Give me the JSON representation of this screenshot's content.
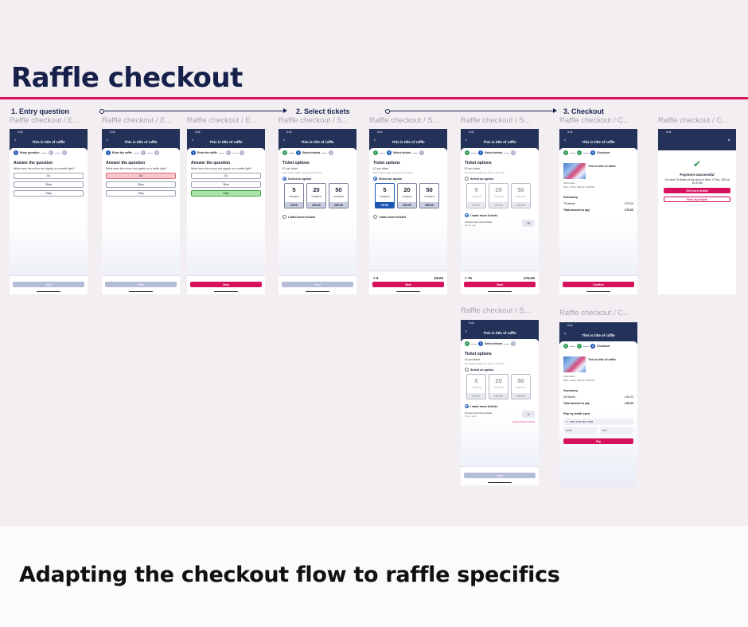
{
  "title": "Raffle checkout",
  "bottom_text": "Adapting the checkout flow to raffle specifics",
  "steps": [
    "1. Entry question",
    "2. Select tickets",
    "3. Checkout"
  ],
  "labels": {
    "entry": "Raffle checkout / E...",
    "select": "Raffle checkout / S...",
    "checkout": "Raffle checkout / C..."
  },
  "phone": {
    "status": "9:41",
    "raffle_title": "This is title of raffle",
    "back": "‹",
    "close": "×"
  },
  "entry": {
    "prog1": "Entry question",
    "prog2": "Enter the raffle",
    "h": "Answer the question",
    "q": "What does the colour red signify on a traffic light?",
    "opts": [
      "Go",
      "Slow",
      "Stop"
    ],
    "next": "Next"
  },
  "tickets": {
    "prog": "Select tickets",
    "h": "Ticket options",
    "price": "£1 per ticket",
    "note": "Each ticket equals one entry in the draw",
    "select": "Select an option",
    "more": "I want more tickets",
    "tlabel": "TICKETS",
    "nums": [
      "5",
      "20",
      "50"
    ],
    "prices": [
      "£5.00",
      "£20.00",
      "£50.00"
    ],
    "choose": "Choose how many tickets",
    "tap": "Tap to edit",
    "qty75": "75",
    "qty3": "3",
    "err": "Enter at least 5 tickets",
    "cart5": "× 5",
    "total5": "£5.00",
    "cart75": "× 75",
    "total75": "£75.00",
    "next": "Next"
  },
  "checkout": {
    "prog": "Checkout",
    "raffle": "This is title of raffle",
    "show": "Show dates",
    "date": "Wed, 17 Dec 2024 at 11:00 AM",
    "summary": "Summary",
    "t75": "75 tickets",
    "v75": "£75.00",
    "total": "Total amount to pay",
    "t35": "35 tickets",
    "v35": "£35.00",
    "confirm": "Confirm",
    "paytitle": "Pay by debit card",
    "card": "9087 4765 0001 2648",
    "exp": "12/24",
    "cvc": "123",
    "pay": "Pay"
  },
  "success": {
    "title": "Payment successful",
    "desc": "You have 75 tickets for the draw on Wed, 17 Dec, 2024 at 11:00 AM",
    "btn1": "Get more tickets",
    "btn2": "View my tickets"
  },
  "colors": {
    "navy": "#16204a",
    "accent": "#d6125e",
    "header": "#24325a",
    "blue": "#1b56b5",
    "green": "#2e9a55"
  }
}
